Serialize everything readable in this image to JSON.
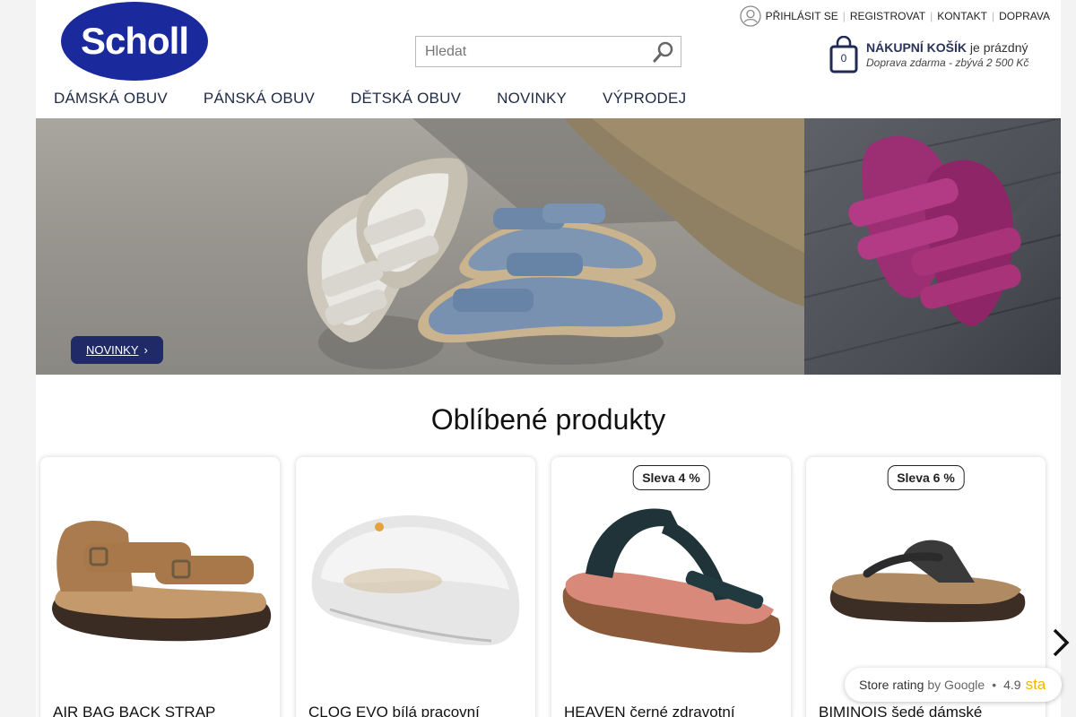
{
  "header": {
    "logo_text": "Scholl",
    "search_placeholder": "Hledat",
    "top_links": [
      "PŘIHLÁSIT SE",
      "REGISTROVAT",
      "KONTAKT",
      "DOPRAVA"
    ],
    "cart": {
      "count": "0",
      "title": "NÁKUPNÍ KOŠÍK",
      "status": "je prázdný",
      "shipping_note": "Doprava zdarma - zbývá 2 500 Kč"
    }
  },
  "nav": [
    "DÁMSKÁ OBUV",
    "PÁNSKÁ OBUV",
    "DĚTSKÁ OBUV",
    "NOVINKY",
    "VÝPRODEJ"
  ],
  "hero": {
    "button_label": "NOVINKY",
    "button_chevron": "›"
  },
  "section_title": "Oblíbené produkty",
  "products": [
    {
      "name": "AIR BAG BACK STRAP",
      "badge": ""
    },
    {
      "name": "CLOG EVO bílá pracovní",
      "badge": ""
    },
    {
      "name": "HEAVEN černé zdravotní",
      "badge": "Sleva 4 %"
    },
    {
      "name": "BIMINOIS šedé dámské",
      "badge": "Sleva 6 %"
    }
  ],
  "rating": {
    "label": "Store rating",
    "by": "by Google",
    "value": "4.9",
    "stars": "sta"
  },
  "colors": {
    "brand_navy": "#1f2a66",
    "logo_blue": "#1a2a9c"
  }
}
